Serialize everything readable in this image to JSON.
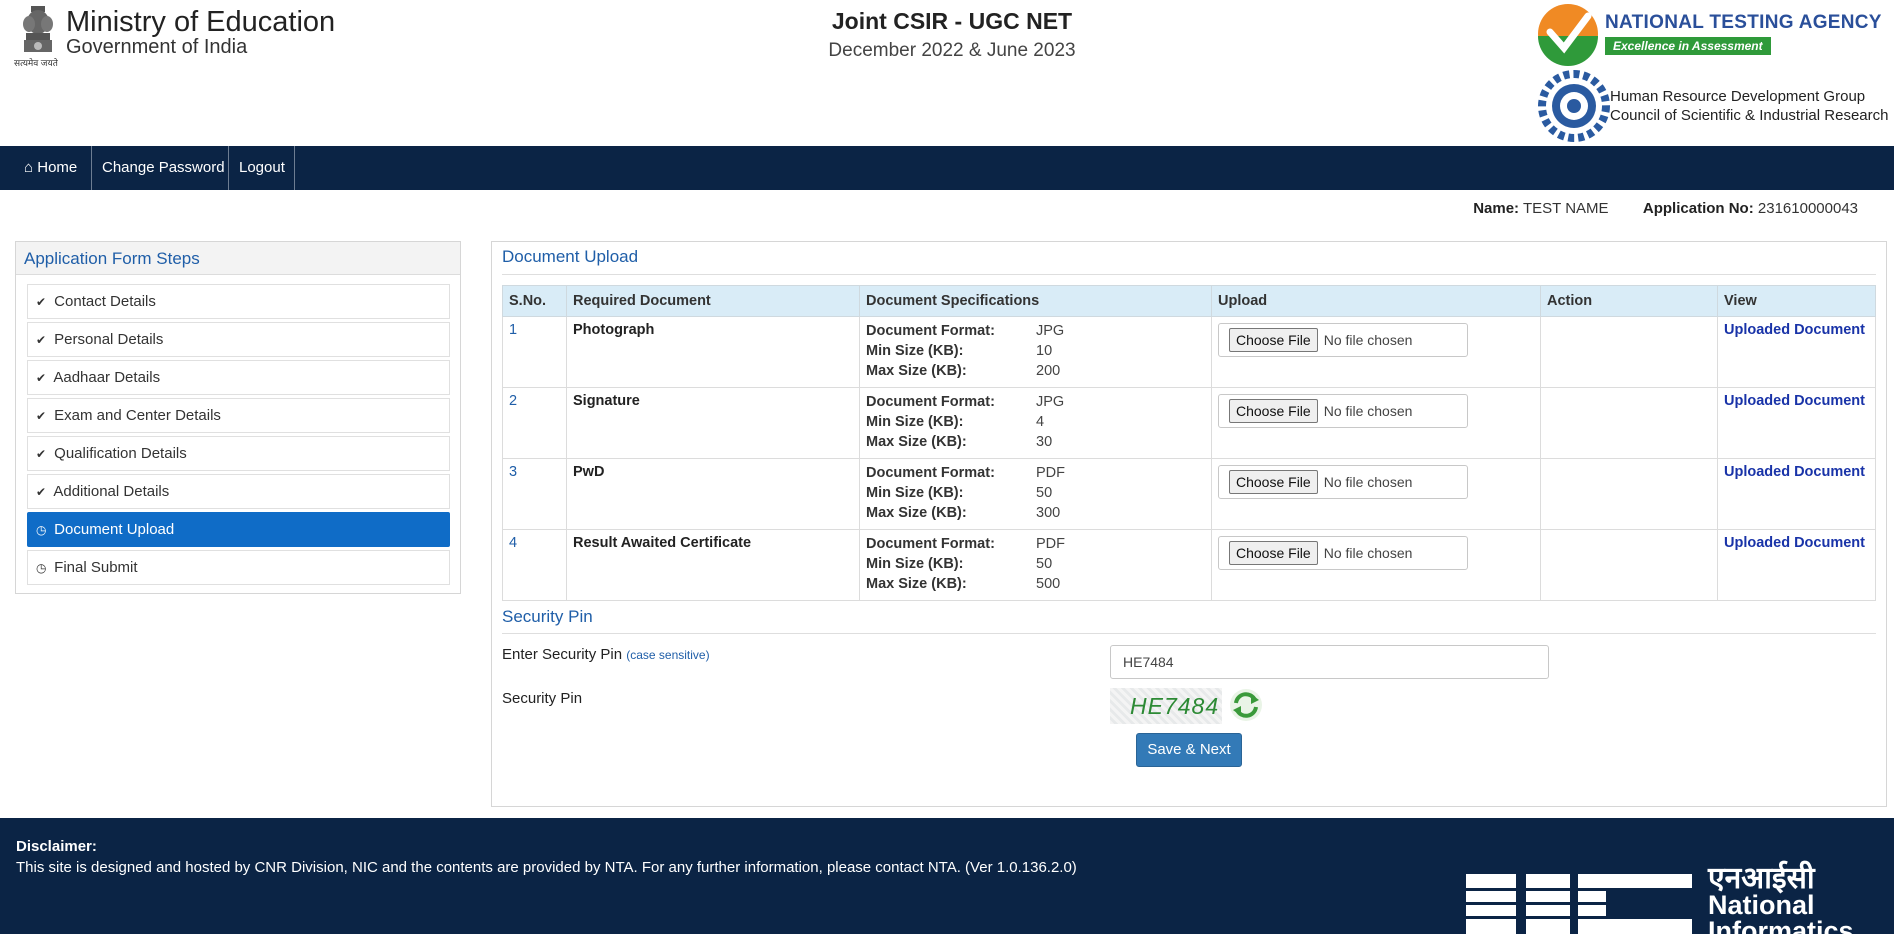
{
  "header": {
    "ministry_title": "Ministry of Education",
    "ministry_sub": "Government of India",
    "emblem_caption": "सत्यमेव जयते",
    "exam_title": "Joint CSIR - UGC NET",
    "exam_sub": "December 2022 & June 2023",
    "nta_title": "NATIONAL TESTING AGENCY",
    "nta_tagline": "Excellence in Assessment",
    "csir_line1": "Human Resource Development Group",
    "csir_line2": "Council of Scientific & Industrial Research"
  },
  "nav": {
    "home": "Home",
    "change_password": "Change Password",
    "logout": "Logout"
  },
  "candidate": {
    "name_label": "Name:",
    "name": "TEST NAME",
    "app_label": "Application No:",
    "app_no": "231610000043"
  },
  "sidebar": {
    "title": "Application Form Steps",
    "steps": [
      {
        "label": "Contact Details",
        "icon": "check-circle-icon"
      },
      {
        "label": "Personal Details",
        "icon": "check-circle-icon"
      },
      {
        "label": "Aadhaar Details",
        "icon": "check-circle-icon"
      },
      {
        "label": "Exam and Center Details",
        "icon": "check-circle-icon"
      },
      {
        "label": "Qualification Details",
        "icon": "check-circle-icon"
      },
      {
        "label": "Additional Details",
        "icon": "check-circle-icon"
      },
      {
        "label": "Document Upload",
        "icon": "clock-icon"
      },
      {
        "label": "Final Submit",
        "icon": "clock-icon"
      }
    ]
  },
  "upload": {
    "title": "Document Upload",
    "columns": [
      "S.No.",
      "Required Document",
      "Document Specifications",
      "Upload",
      "Action",
      "View"
    ],
    "spec_labels": {
      "format": "Document Format:",
      "min": "Min Size (KB):",
      "max": "Max Size (KB):"
    },
    "choose_label": "Choose File",
    "no_file_label": "No file chosen",
    "view_label": "Uploaded Document",
    "rows": [
      {
        "sno": "1",
        "doc": "Photograph",
        "format": "JPG",
        "min": "10",
        "max": "200"
      },
      {
        "sno": "2",
        "doc": "Signature",
        "format": "JPG",
        "min": "4",
        "max": "30"
      },
      {
        "sno": "3",
        "doc": "PwD",
        "format": "PDF",
        "min": "50",
        "max": "300"
      },
      {
        "sno": "4",
        "doc": "Result Awaited Certificate",
        "format": "PDF",
        "min": "50",
        "max": "500"
      }
    ]
  },
  "security": {
    "title": "Security Pin",
    "enter_label": "Enter Security Pin",
    "case_note": "(case sensitive)",
    "pin_label": "Security Pin",
    "input_value": "HE7484",
    "captcha_text": "HE7484",
    "save_label": "Save & Next"
  },
  "footer": {
    "disclaimer_head": "Disclaimer:",
    "disclaimer_text": "This site is designed and hosted by CNR Division, NIC and the contents are provided by NTA. For any further information, please contact NTA. (Ver 1.0.136.2.0)",
    "nic_hindi": "एनआईसी",
    "nic_line1": "National",
    "nic_line2": "Informatics"
  },
  "colors": {
    "navy": "#0b2445",
    "accent_blue": "#1f5ea8",
    "active_step": "#0f6cc7",
    "table_head": "#d9ecf7",
    "button": "#337ab7"
  }
}
